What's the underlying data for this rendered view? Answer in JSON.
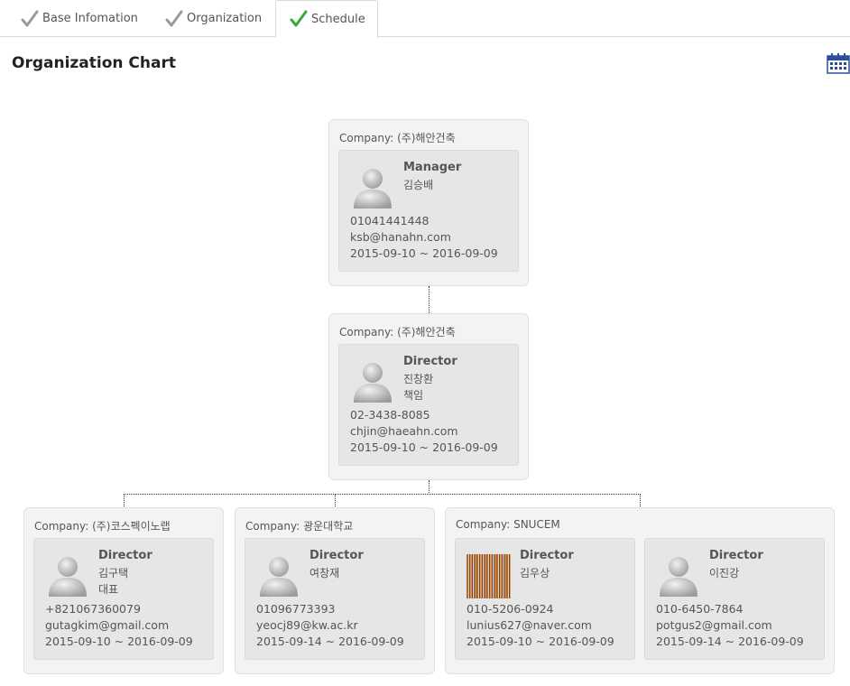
{
  "tabs": [
    {
      "label": "Base Infomation",
      "check_color": "#9a9a9a"
    },
    {
      "label": "Organization",
      "check_color": "#9a9a9a"
    },
    {
      "label": "Schedule",
      "check_color": "#3aa83a"
    }
  ],
  "page_title": "Organization Chart",
  "company_prefix": "Company: ",
  "nodes": [
    {
      "company": "Company: (주)해안건축",
      "people": [
        {
          "role": "Manager",
          "name": "김승배",
          "title": "",
          "phone": "01041441448",
          "email": "ksb@hanahn.com",
          "period": "2015-09-10 ~ 2016-09-09"
        }
      ]
    },
    {
      "company": "Company: (주)해안건축",
      "people": [
        {
          "role": "Director",
          "name": "진창환",
          "title": "책임",
          "phone": "02-3438-8085",
          "email": "chjin@haeahn.com",
          "period": "2015-09-10 ~ 2016-09-09"
        }
      ]
    },
    {
      "company": "Company: (주)코스펙이노랩",
      "people": [
        {
          "role": "Director",
          "name": "김구택",
          "title": "대표",
          "phone": "+821067360079",
          "email": "gutagkim@gmail.com",
          "period": "2015-09-10 ~ 2016-09-09"
        }
      ]
    },
    {
      "company": "Company: 광운대학교",
      "people": [
        {
          "role": "Director",
          "name": "여창재",
          "title": "",
          "phone": "01096773393",
          "email": "yeocj89@kw.ac.kr",
          "period": "2015-09-14 ~ 2016-09-09"
        }
      ]
    },
    {
      "company": "Company: SNUCEM",
      "people": [
        {
          "role": "Director",
          "name": "김우상",
          "title": "",
          "phone": "010-5206-0924",
          "email": "lunius627@naver.com",
          "period": "2015-09-10 ~ 2016-09-09"
        },
        {
          "role": "Director",
          "name": "이진강",
          "title": "",
          "phone": "010-6450-7864",
          "email": "potgus2@gmail.com",
          "period": "2015-09-14 ~ 2016-09-09"
        }
      ]
    }
  ]
}
